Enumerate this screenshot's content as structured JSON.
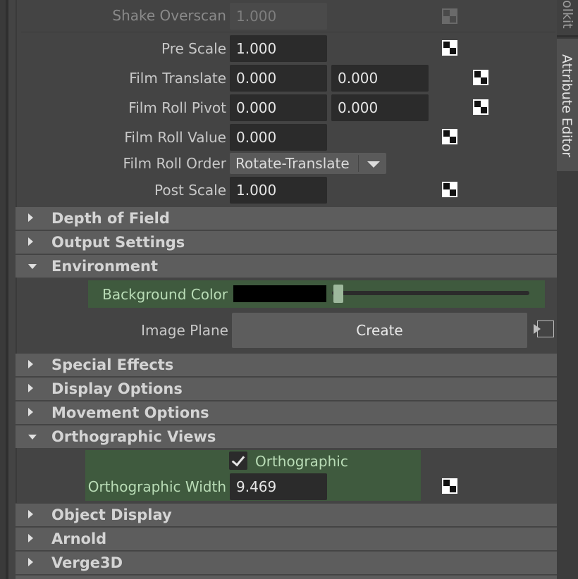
{
  "camera_attrs": {
    "shake_overscan": {
      "label": "Shake Overscan",
      "value": "1.000"
    },
    "pre_scale": {
      "label": "Pre Scale",
      "value": "1.000"
    },
    "film_translate": {
      "label": "Film Translate",
      "x": "0.000",
      "y": "0.000"
    },
    "film_roll_pivot": {
      "label": "Film Roll Pivot",
      "x": "0.000",
      "y": "0.000"
    },
    "film_roll_value": {
      "label": "Film Roll Value",
      "value": "0.000"
    },
    "film_roll_order": {
      "label": "Film Roll Order",
      "value": "Rotate-Translate"
    },
    "post_scale": {
      "label": "Post Scale",
      "value": "1.000"
    }
  },
  "sections": {
    "depth_of_field": "Depth of Field",
    "output_settings": "Output Settings",
    "environment": "Environment",
    "special_effects": "Special Effects",
    "display_options": "Display Options",
    "movement_options": "Movement Options",
    "orthographic_views": "Orthographic Views",
    "object_display": "Object Display",
    "arnold": "Arnold",
    "verge3d": "Verge3D"
  },
  "environment": {
    "background_color_label": "Background Color",
    "background_color_value": "#000000",
    "slider_level": 0.02,
    "image_plane_label": "Image Plane",
    "create_label": "Create"
  },
  "orthographic": {
    "checkbox_label": "Orthographic",
    "checked": true,
    "width_label": "Orthographic Width",
    "width_value": "9.469"
  },
  "side_tabs": {
    "toolkit": "olkit",
    "attribute_editor": "Attribute Editor"
  },
  "icons": {
    "keyframe": "keyframe-checker-icon",
    "expand": "triangle-right-icon",
    "collapse": "triangle-down-icon",
    "dropdown": "chevron-down-icon",
    "map_button": "map-input-icon",
    "check": "checkmark-icon"
  },
  "colors": {
    "highlight_green": "#3f5a3e",
    "section_header": "#5d5d5d",
    "field_bg": "#2b2b2b"
  }
}
